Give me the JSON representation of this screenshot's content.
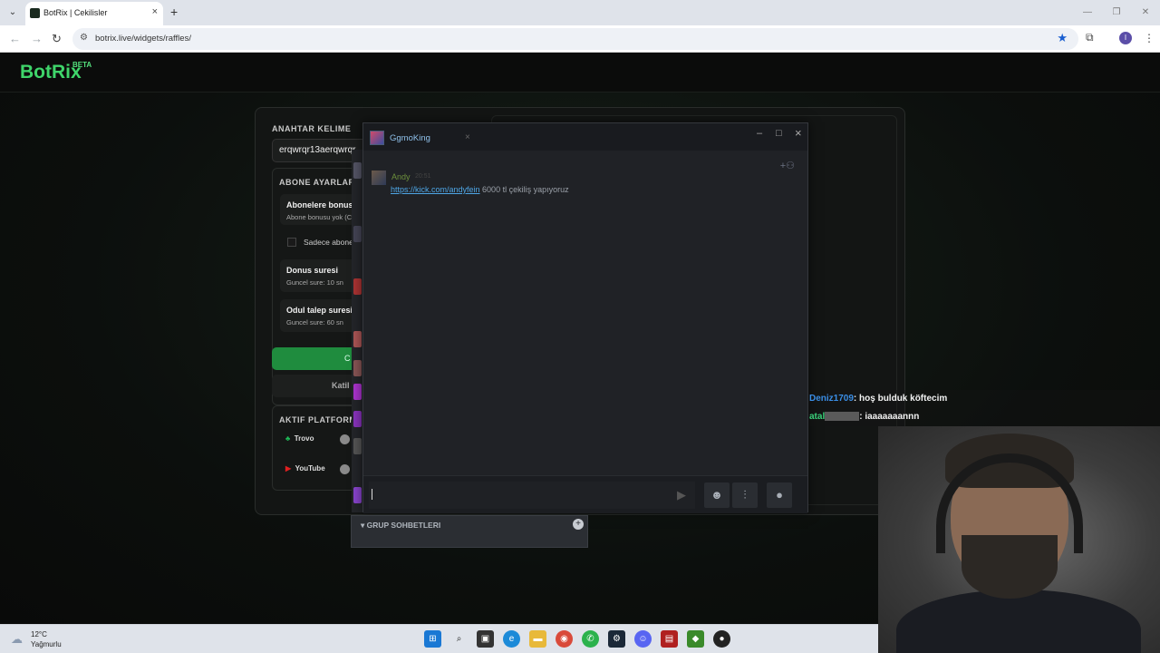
{
  "browser": {
    "tab_title": "BotRix | Cekilisler",
    "tab_close": "×",
    "new_tab": "+",
    "url": "botrix.live/widgets/raffles/",
    "profile_initial": "I"
  },
  "site": {
    "logo": "BotRix",
    "logo_badge": "BETA"
  },
  "raffle": {
    "keyword_label": "ANAHTAR KELIME",
    "keyword_value": "erqwrqr13aerqwrqr",
    "sub_settings_label": "ABONE AYARLARI",
    "sub_bonus_title": "Abonelere bonus",
    "sub_bonus_sub": "Abone bonusu yok (C",
    "only_subs_label": "Sadece abone",
    "duration_title": "Donus suresi",
    "duration_sub": "Guncel sure: 10 sn",
    "claim_title": "Odul talep suresi",
    "claim_sub": "Guncel sure: 60 sn",
    "start_button": "C",
    "join_button": "Katil",
    "platforms_label": "AKTIF PLATFORM",
    "platforms": [
      {
        "name": "Trovo",
        "color": "#1fbf5a"
      },
      {
        "name": "YouTube",
        "color": "#e02020"
      }
    ]
  },
  "steam_chat": {
    "tab_name": "GgmoKing",
    "tab_close": "×",
    "window_minimize": "–",
    "window_maximize": "□",
    "window_close": "×",
    "message": {
      "sender": "Andy",
      "time": "20:51",
      "link": "https://kick.com/andyfein",
      "text": " 6000 tl çekiliş yapıyoruz"
    },
    "group_chats_label": "GRUP SOHBETLERI"
  },
  "overlay_chat": [
    {
      "user": "Deniz1709",
      "user_color": "#3a8ee6",
      "text": ": hoş bulduk köftecim"
    },
    {
      "user": "atal",
      "user_color": "#3ad07a",
      "text": ": iaaaaaaannn"
    }
  ],
  "taskbar": {
    "temperature": "12°C",
    "weather": "Yağmurlu"
  }
}
